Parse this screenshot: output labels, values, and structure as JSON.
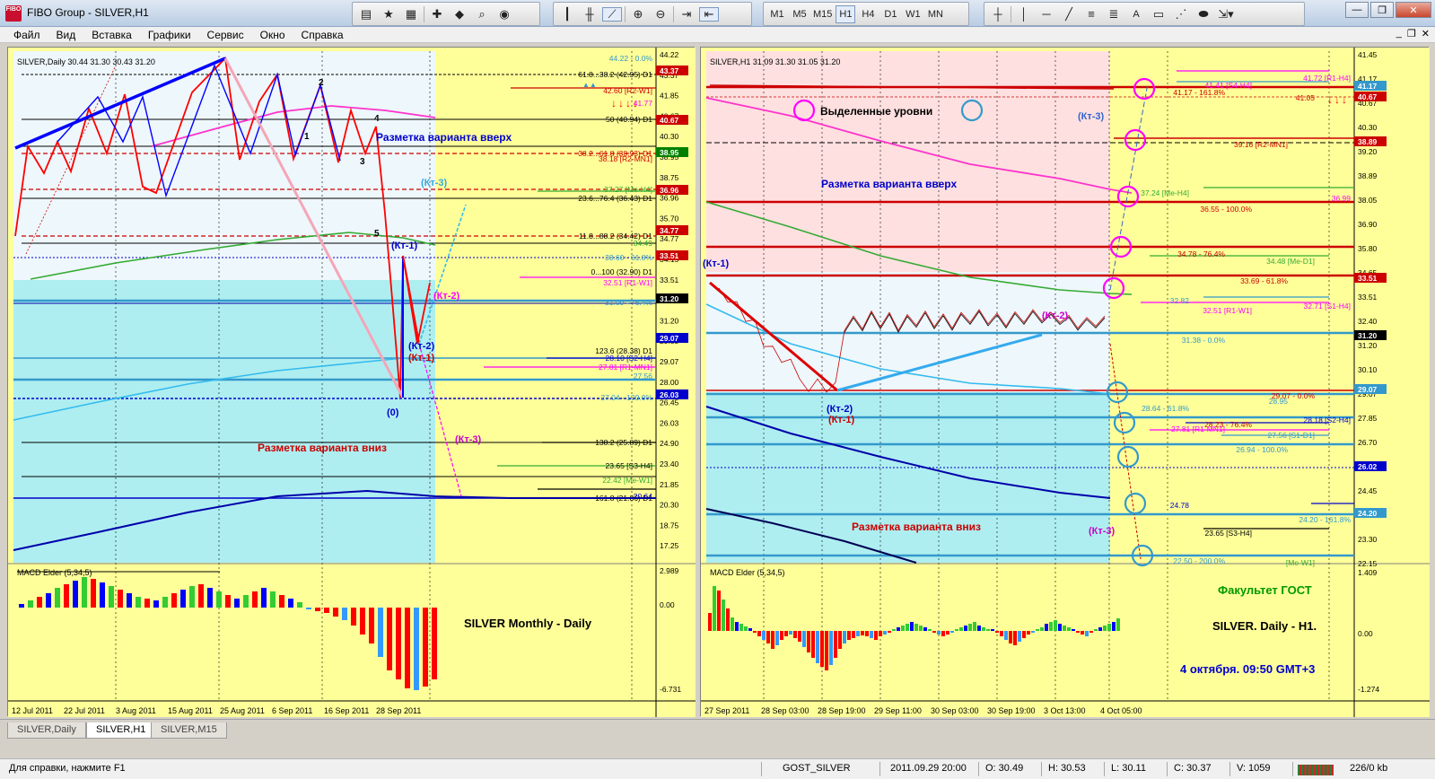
{
  "window": {
    "title": "FIBO Group - SILVER,H1",
    "logo": "FIBO"
  },
  "toolbar": {
    "timeframes": [
      "M1",
      "M5",
      "M15",
      "H1",
      "H4",
      "D1",
      "W1",
      "MN"
    ],
    "active_timeframe": "H1",
    "text_tool": "A"
  },
  "menu": [
    "Файл",
    "Вид",
    "Вставка",
    "Графики",
    "Сервис",
    "Окно",
    "Справка"
  ],
  "left_chart": {
    "header": "SILVER,Daily  30.44 31.30 30.43 31.20",
    "indicator_header": "MACD Elder (5,34,5)",
    "title_text": "SILVER  Monthly - Daily",
    "up_label": "Разметка варианта вверх",
    "down_label": "Разметка варианта вниз",
    "wave_labels": [
      "1",
      "2",
      "3",
      "4",
      "5"
    ],
    "kt_labels": {
      "kt1": "(Кт-1)",
      "kt2": "(Кт-2)",
      "kt3": "(Кт-3)",
      "zero": "(0)"
    },
    "price_axis": [
      "44.22",
      "43.37",
      "41.85",
      "40.67",
      "40.30",
      "38.95",
      "38.75",
      "36.96",
      "35.70",
      "34.77",
      "34.15",
      "33.51",
      "32.60",
      "31.20",
      "29.55",
      "29.07",
      "28.00",
      "26.45",
      "26.03",
      "24.90",
      "23.40",
      "21.85",
      "20.30",
      "18.75",
      "17.25"
    ],
    "price_tags": [
      {
        "label": "43.37",
        "color": "#cc0000"
      },
      {
        "label": "40.67",
        "color": "#cc0000"
      },
      {
        "label": "38.95",
        "color": "#008000"
      },
      {
        "label": "36.96",
        "color": "#cc0000"
      },
      {
        "label": "34.77",
        "color": "#cc0000"
      },
      {
        "label": "33.51",
        "color": "#cc0000"
      },
      {
        "label": "31.20",
        "color": "#000000"
      },
      {
        "label": "29.07",
        "color": "#0000cc"
      },
      {
        "label": "26.03",
        "color": "#0000cc"
      }
    ],
    "macd_axis": [
      "2.989",
      "0.00",
      "-6.731"
    ],
    "time_axis": [
      "12 Jul 2011",
      "22 Jul 2011",
      "3 Aug 2011",
      "15 Aug 2011",
      "25 Aug 2011",
      "6 Sep 2011",
      "16 Sep 2011",
      "28 Sep 2011"
    ],
    "levels": [
      {
        "text": "44.22 - 0.0%",
        "color": "#3399cc"
      },
      {
        "text": "61.8...38.2 (42.95) D1",
        "color": "#000000"
      },
      {
        "text": "42.60 [R2-W1]",
        "color": "#cc0000"
      },
      {
        "text": "41.77",
        "color": "#ff00ff"
      },
      {
        "text": "50 (40.94) D1",
        "color": "#000000"
      },
      {
        "text": "38.2...61.8 (38.93) D1",
        "color": "#cc0000"
      },
      {
        "text": "38.18 [R2-MN1]",
        "color": "#cc0000"
      },
      {
        "text": "37.27 [Me-H4]",
        "color": "#33aa33"
      },
      {
        "text": "23.6...76.4 (36.43) D1",
        "color": "#000000"
      },
      {
        "text": "11.8...88.2 (34.42) D1",
        "color": "#000000"
      },
      {
        "text": "34.49",
        "color": "#33aa33"
      },
      {
        "text": "33.60 - 61.8%",
        "color": "#3399cc"
      },
      {
        "text": "0...100 (32.90) D1",
        "color": "#000000"
      },
      {
        "text": "32.51 [R1-W1]",
        "color": "#ff00ff"
      },
      {
        "text": "31.09 - 76.4%",
        "color": "#3399cc"
      },
      {
        "text": "123.6 (28.38) D1",
        "color": "#000000"
      },
      {
        "text": "28.10 [S2-H4]",
        "color": "#0000cc"
      },
      {
        "text": "27.81 [R1-MN1]",
        "color": "#ff00ff"
      },
      {
        "text": "27.56",
        "color": "#3399cc"
      },
      {
        "text": "27.04 - 100.0%",
        "color": "#3399cc"
      },
      {
        "text": "138.2 (25.89) D1",
        "color": "#000000"
      },
      {
        "text": "23.65 [S3-H4]",
        "color": "#000000"
      },
      {
        "text": "22.42 [Me-W1]",
        "color": "#33aa33"
      },
      {
        "text": "161.8 (21.86) D1",
        "color": "#000000"
      },
      {
        "text": "20.64",
        "color": "#0000cc"
      }
    ]
  },
  "right_chart": {
    "header": "SILVER,H1  31.09 31.30 31.05 31.20",
    "indicator_header": "MACD Elder (5,34,5)",
    "legend_text": "Выделенные уровни",
    "up_label": "Разметка варианта вверх",
    "down_label": "Разметка варианта вниз",
    "kt_labels": {
      "kt1": "(Кт-1)",
      "kt2": "(Кт-2)",
      "kt3": "(Кт-3)"
    },
    "faculty": "Факультет ГОСТ",
    "subtitle": "SILVER. Daily - H1.",
    "date_text": "4 октября. 09:50 GMT+3",
    "price_axis": [
      "41.45",
      "41.17",
      "40.67",
      "40.30",
      "39.20",
      "38.89",
      "38.05",
      "36.90",
      "35.80",
      "34.65",
      "33.51",
      "32.40",
      "31.20",
      "30.10",
      "29.07",
      "27.85",
      "26.70",
      "26.02",
      "24.45",
      "24.20",
      "23.30",
      "22.15"
    ],
    "price_tags": [
      {
        "label": "41.17",
        "color": "#3399cc"
      },
      {
        "label": "40.67",
        "color": "#cc0000"
      },
      {
        "label": "38.89",
        "color": "#cc0000"
      },
      {
        "label": "33.51",
        "color": "#cc0000"
      },
      {
        "label": "31.20",
        "color": "#000000"
      },
      {
        "label": "29.07",
        "color": "#3399cc"
      },
      {
        "label": "26.02",
        "color": "#0000cc"
      },
      {
        "label": "24.20",
        "color": "#3399cc"
      }
    ],
    "macd_axis": [
      "1.409",
      "0.00",
      "-1.274"
    ],
    "time_axis": [
      "27 Sep 2011",
      "28 Sep 03:00",
      "28 Sep 19:00",
      "29 Sep 11:00",
      "30 Sep 03:00",
      "30 Sep 19:00",
      "3 Oct 13:00",
      "4 Oct 05:00"
    ],
    "levels": [
      {
        "text": "41.72 [R1-H4]",
        "color": "#ff00ff"
      },
      {
        "text": "41.41 [S4-H4]",
        "color": "#ff00ff"
      },
      {
        "text": "41.17 - 161.8%",
        "color": "#cc0000"
      },
      {
        "text": "41.05",
        "color": "#cc0000"
      },
      {
        "text": "39.16 [R2-MN1]",
        "color": "#cc0000"
      },
      {
        "text": "37.24 [Me-H4]",
        "color": "#33aa33"
      },
      {
        "text": "36.99",
        "color": "#ff00ff"
      },
      {
        "text": "36.55 - 100.0%",
        "color": "#cc0000"
      },
      {
        "text": "34.78 - 76.4%",
        "color": "#cc0000"
      },
      {
        "text": "34.48 [Me-D1]",
        "color": "#33aa33"
      },
      {
        "text": "33.69 - 61.8%",
        "color": "#cc0000"
      },
      {
        "text": "32.82",
        "color": "#3399cc"
      },
      {
        "text": "32.71 [S1-H4]",
        "color": "#ff00ff"
      },
      {
        "text": "32.51 [R1-W1]",
        "color": "#ff00ff"
      },
      {
        "text": "31.38 - 0.0%",
        "color": "#3399cc"
      },
      {
        "text": "29.07 - 0.0%",
        "color": "#cc0000"
      },
      {
        "text": "28.95",
        "color": "#3399cc"
      },
      {
        "text": "28.64 - 61.8%",
        "color": "#3399cc"
      },
      {
        "text": "28.18 [S2-H4]",
        "color": "#0000cc"
      },
      {
        "text": "28.23 - 76.4%",
        "color": "#cc0000"
      },
      {
        "text": "27.81 [R1-MN1]",
        "color": "#ff00ff"
      },
      {
        "text": "27.56 [S1-D1]",
        "color": "#3399cc"
      },
      {
        "text": "26.94 - 100.0%",
        "color": "#3399cc"
      },
      {
        "text": "24.78",
        "color": "#0000cc"
      },
      {
        "text": "24.20 - 161.8%",
        "color": "#3399cc"
      },
      {
        "text": "23.65 [S3-H4]",
        "color": "#000000"
      },
      {
        "text": "22.50 - 200.0%",
        "color": "#3399cc"
      },
      {
        "text": "[Me-W1]",
        "color": "#33aa33"
      }
    ]
  },
  "tabs": [
    "SILVER,Daily",
    "SILVER,H1",
    "SILVER,M15"
  ],
  "active_tab": "SILVER,H1",
  "status": {
    "help": "Для справки, нажмите F1",
    "profile": "GOST_SILVER",
    "datetime": "2011.09.29 20:00",
    "open": "O: 30.49",
    "high": "H: 30.53",
    "low": "L: 30.11",
    "close": "C: 30.37",
    "volume": "V: 1059",
    "traffic": "226/0 kb"
  },
  "colors": {
    "chart_bg": "#ffff99",
    "cyan_zone": "#aeeef0",
    "light_zone": "#eef7fb",
    "pink_zone": "#ffe0e0",
    "up_color": "#0000ff",
    "down_color": "#ff0000"
  }
}
